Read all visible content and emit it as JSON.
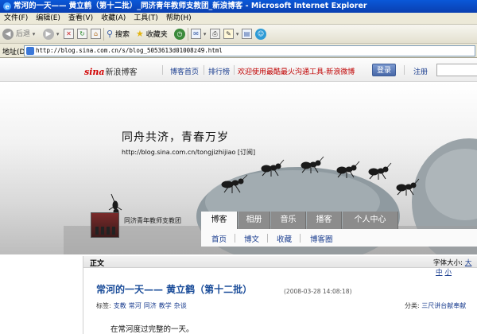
{
  "window": {
    "title": "常河的一天—— 黄立鹤（第十二批）_同济青年教师支教团_新浪博客 - Microsoft Internet Explorer"
  },
  "menu": [
    "文件(F)",
    "编辑(E)",
    "查看(V)",
    "收藏(A)",
    "工具(T)",
    "帮助(H)"
  ],
  "toolbar": {
    "back_label": "后退",
    "search_label": "搜索",
    "favorites_label": "收藏夹"
  },
  "address": {
    "label": "地址(D)",
    "url": "http://blog.sina.com.cn/s/blog_5053613d01008z49.html"
  },
  "header": {
    "logo_en": "sina",
    "logo_cn": "新浪博客",
    "nav": [
      "博客首页",
      "排行榜"
    ],
    "promo": "欢迎使用最酷最火沟通工具-新浪微博",
    "login_label": "登录",
    "register_label": "注册"
  },
  "banner": {
    "title": "同舟共济，青春万岁",
    "url": "http://blog.sina.com.cn/tongjizhijiao [订阅]"
  },
  "profile": {
    "name": "同济青年教师支教团"
  },
  "tabs": [
    "博客",
    "相册",
    "音乐",
    "播客",
    "个人中心"
  ],
  "subnav": [
    "首页",
    "博文",
    "收藏",
    "博客圈"
  ],
  "article": {
    "section_label": "正文",
    "font_size_label": "字体大小:",
    "font_sizes": [
      "大",
      "中",
      "小"
    ],
    "title": "常河的一天—— 黄立鹤（第十二批）",
    "date": "(2008-03-28 14:08:18)",
    "tags_label": "标签:",
    "tags": [
      "支教",
      "常河",
      "同济",
      "教学",
      "杂谈"
    ],
    "category_label": "分类:",
    "category": "三尺讲台献奉献",
    "body_first_line": "在常河度过完整的一天。"
  }
}
